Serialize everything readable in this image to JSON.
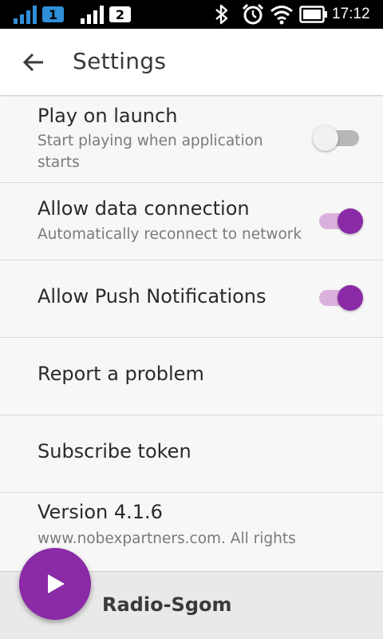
{
  "status_bar": {
    "sim1_label": "1",
    "sim2_label": "2",
    "icons": [
      "signal-bars-icon",
      "bluetooth-icon",
      "alarm-icon",
      "wifi-icon",
      "battery-icon"
    ],
    "time": "17:12"
  },
  "header": {
    "title": "Settings",
    "back_icon": "arrow-left-icon"
  },
  "settings": [
    {
      "title": "Play on launch",
      "subtitle": "Start playing when application starts",
      "toggle": "off"
    },
    {
      "title": "Allow data connection",
      "subtitle": "Automatically reconnect to network",
      "toggle": "on"
    },
    {
      "title": "Allow Push Notifications",
      "subtitle": "",
      "toggle": "on"
    },
    {
      "title": "Report a problem",
      "subtitle": ""
    },
    {
      "title": "Subscribe token",
      "subtitle": ""
    },
    {
      "title": "Version 4.1.6",
      "subtitle": "www.nobexpartners.com. All rights"
    }
  ],
  "player": {
    "station_name": "Radio-Sgom",
    "play_icon": "play-icon"
  },
  "colors": {
    "accent": "#8a2aa6",
    "toggle_track_on": "#dab1dd",
    "toggle_track_off": "#b7b7b7",
    "status_bar_bg": "#000000",
    "sim1_badge": "#2f8fd8"
  }
}
